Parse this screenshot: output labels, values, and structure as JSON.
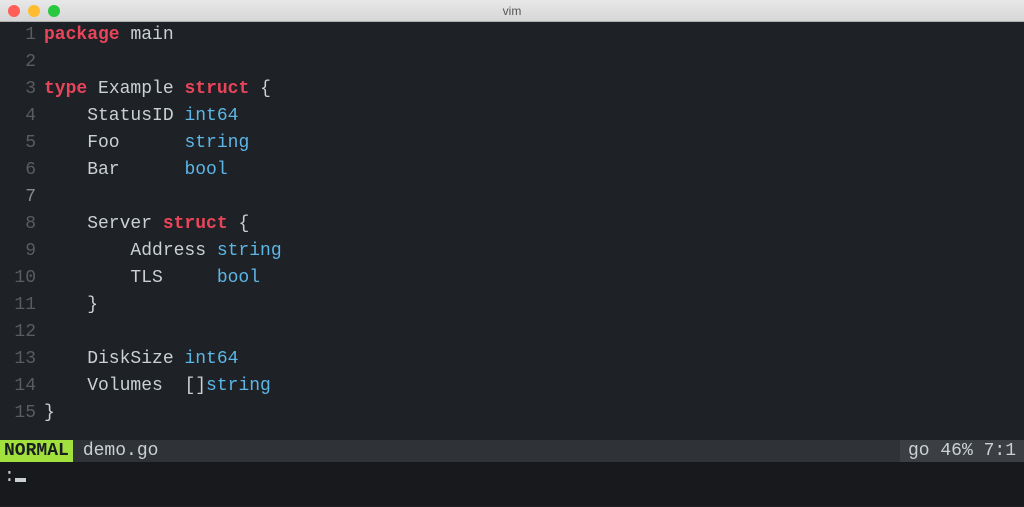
{
  "window": {
    "title": "vim"
  },
  "editor": {
    "lines": [
      {
        "n": 1,
        "tokens": [
          {
            "t": "package",
            "c": "kw-decl"
          },
          {
            "t": " ",
            "c": ""
          },
          {
            "t": "main",
            "c": "ident"
          }
        ]
      },
      {
        "n": 2,
        "tokens": []
      },
      {
        "n": 3,
        "tokens": [
          {
            "t": "type",
            "c": "kw-decl"
          },
          {
            "t": " ",
            "c": ""
          },
          {
            "t": "Example",
            "c": "ident"
          },
          {
            "t": " ",
            "c": ""
          },
          {
            "t": "struct",
            "c": "kw-type"
          },
          {
            "t": " {",
            "c": "ident"
          }
        ]
      },
      {
        "n": 4,
        "tokens": [
          {
            "t": "    StatusID ",
            "c": "ident"
          },
          {
            "t": "int64",
            "c": "typename"
          }
        ]
      },
      {
        "n": 5,
        "tokens": [
          {
            "t": "    Foo      ",
            "c": "ident"
          },
          {
            "t": "string",
            "c": "typename"
          }
        ]
      },
      {
        "n": 6,
        "tokens": [
          {
            "t": "    Bar      ",
            "c": "ident"
          },
          {
            "t": "bool",
            "c": "typename"
          }
        ]
      },
      {
        "n": 7,
        "tokens": [],
        "current": true
      },
      {
        "n": 8,
        "tokens": [
          {
            "t": "    Server ",
            "c": "ident"
          },
          {
            "t": "struct",
            "c": "kw-type"
          },
          {
            "t": " {",
            "c": "ident"
          }
        ]
      },
      {
        "n": 9,
        "tokens": [
          {
            "t": "        Address ",
            "c": "ident"
          },
          {
            "t": "string",
            "c": "typename"
          }
        ]
      },
      {
        "n": 10,
        "tokens": [
          {
            "t": "        TLS     ",
            "c": "ident"
          },
          {
            "t": "bool",
            "c": "typename"
          }
        ]
      },
      {
        "n": 11,
        "tokens": [
          {
            "t": "    }",
            "c": "ident"
          }
        ]
      },
      {
        "n": 12,
        "tokens": []
      },
      {
        "n": 13,
        "tokens": [
          {
            "t": "    DiskSize ",
            "c": "ident"
          },
          {
            "t": "int64",
            "c": "typename"
          }
        ]
      },
      {
        "n": 14,
        "tokens": [
          {
            "t": "    Volumes  ",
            "c": "ident"
          },
          {
            "t": "[]",
            "c": "ident"
          },
          {
            "t": "string",
            "c": "typename"
          }
        ]
      },
      {
        "n": 15,
        "tokens": [
          {
            "t": "}",
            "c": "ident"
          }
        ]
      }
    ]
  },
  "status": {
    "mode": "NORMAL",
    "filename": "demo.go",
    "filetype": "go",
    "percent": "46%",
    "position": "7:1"
  },
  "cmd": {
    "prompt": ":"
  }
}
